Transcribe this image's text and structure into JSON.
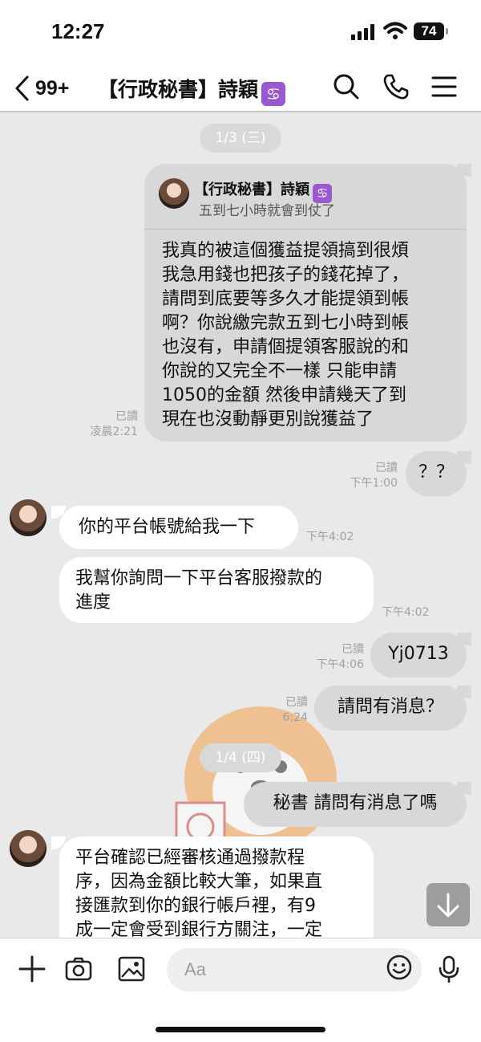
{
  "status": {
    "time": "12:27",
    "battery": "74"
  },
  "header": {
    "unread_count": "99+",
    "title": "【行政秘書】詩穎",
    "zodiac_glyph": "♋"
  },
  "messages": [
    {
      "type": "date",
      "text": "1/3 (三)"
    },
    {
      "type": "out_reply",
      "reply_name": "【行政秘書】詩穎",
      "reply_snippet": "五到七小時就會到仗了",
      "lines": [
        "我真的被這個獲益提領搞到很煩",
        "我急用錢也把孩子的錢花掉了，",
        "請問到底要等多久才能提領到帳",
        "啊？你說繳完款五到七小時到帳",
        "也沒有，申請個提領客服說的和",
        "你說的又完全不一樣 只能申請",
        "1050的金額 然後申請幾天了到",
        "現在也沒動靜更別說獲益了"
      ],
      "read": "已讀",
      "time": "凌晨2:21"
    },
    {
      "type": "out",
      "text": "？？",
      "read": "已讀",
      "time": "下午1:00"
    },
    {
      "type": "in",
      "text": "你的平台帳號給我一下",
      "time": "下午4:02"
    },
    {
      "type": "in",
      "lines": [
        "我幫你詢問一下平台客服撥款的",
        "進度"
      ],
      "time": "下午4:02"
    },
    {
      "type": "out",
      "text": "Yj0713",
      "read": "已讀",
      "time": "下午4:06"
    },
    {
      "type": "out",
      "text": "請問有消息？",
      "read": "已讀",
      "time": "6:24"
    },
    {
      "type": "date",
      "text": "1/4 (四)"
    },
    {
      "type": "out",
      "text": "秘書 請問有消息了嗎"
    },
    {
      "type": "in",
      "lines": [
        "平台確認已經審核通過撥款程",
        "序，因為金額比較大筆，如果直",
        "接匯款到你的銀行帳戶裡，有9",
        "成一定會受到銀行方關注，一定"
      ]
    }
  ],
  "input": {
    "placeholder": "Aa"
  },
  "colors": {
    "out_bubble": "#d8d8d8",
    "in_bubble": "#ffffff",
    "chat_bg": "#e9e9e9",
    "zodiac_badge": "#9b59d0"
  },
  "icons": [
    "back-chevron-icon",
    "search-icon",
    "phone-icon",
    "menu-icon",
    "plus-icon",
    "camera-icon",
    "image-icon",
    "emoji-icon",
    "mic-icon",
    "arrow-down-icon"
  ]
}
